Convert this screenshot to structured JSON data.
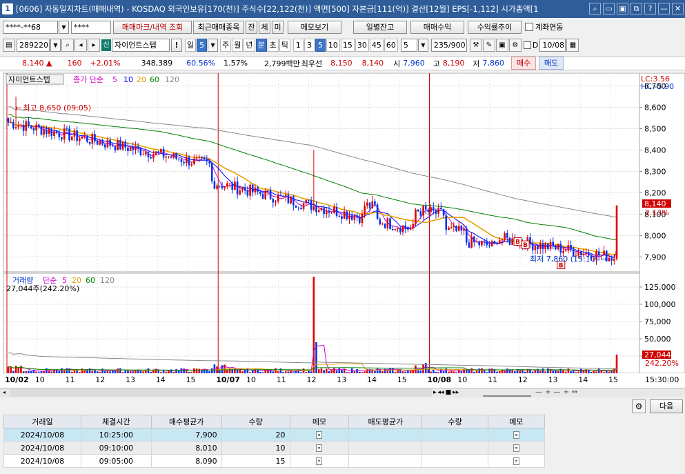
{
  "title": {
    "num": "1",
    "text": "[0606] 자동일지차트(매매내역) - KOSDAQ 외국인보유[170(천)] 주식수[22,122(천)] 액면[500] 자본금[111(억)] 결산[12월] EPS[-1,112] 시가총액[1"
  },
  "window_buttons": [
    "⌕",
    "▭",
    "▣",
    "⧉",
    "?",
    "—",
    "✕"
  ],
  "row1": {
    "account": "****-**68",
    "password": "****",
    "mark_btn": "매매마크/내역 조회",
    "recent_btn": "최근매매종목",
    "jan": "잔",
    "che": "체",
    "mi": "미",
    "memo_btn": "메모보기",
    "daily_btn": "일별잔고",
    "profit_btn": "매매수익",
    "rate_btn": "수익률추이",
    "link_label": "계좌연동"
  },
  "row2": {
    "code": "289220",
    "badge": "신",
    "stock_name": "자이언트스텝",
    "warn": "!",
    "day": "일",
    "day_val": "5",
    "periods": [
      "주",
      "월",
      "년",
      "분",
      "초",
      "틱",
      "1",
      "3",
      "5",
      "10",
      "15",
      "30",
      "45",
      "60"
    ],
    "count": "5",
    "view": "235/900",
    "d_label": "D",
    "date": "10/08"
  },
  "quote": {
    "price": "8,140 ▲",
    "change": "160",
    "pct": "+2.01%",
    "volume": "348,389",
    "vol_ratio": "60.56%",
    "turnover": "1.57%",
    "amount": "2,799백만",
    "first": "최우선",
    "bid1": "8,150",
    "bid2": "8,140",
    "open_label": "시",
    "open": "7,960",
    "high_label": "고",
    "high": "8,190",
    "low_label": "저",
    "low": "7,860",
    "buy_btn": "매수",
    "sell_btn": "매도"
  },
  "chart": {
    "stock_label": "자이언트스텝",
    "ma_label": "종가 단순",
    "ma_periods": [
      "5",
      "10",
      "20",
      "60",
      "120"
    ],
    "ma_colors": [
      "#cc00cc",
      "#0000ff",
      "#e8a000",
      "#008000",
      "#888888"
    ],
    "lc": "LC:3.56",
    "hc": "HC:-5.90",
    "high_note": "최고 8,650 (09:05)",
    "low_note": "최저 7,860 (15:10)",
    "price_axis": [
      "8,700",
      "8,600",
      "8,500",
      "8,400",
      "8,300",
      "8,200",
      "8,100",
      "8,000",
      "7,900"
    ],
    "price_axis_values": [
      8700,
      8600,
      8500,
      8400,
      8300,
      8200,
      8100,
      8000,
      7900
    ],
    "cur_price": "8,140",
    "cur_pct": "2.13%",
    "vol_label": "거래량",
    "vol_ma_label": "단순",
    "vol_ma_periods": [
      "5",
      "20",
      "60",
      "120"
    ],
    "vol_sub": "27,044주(242.20%)",
    "vol_axis": [
      "125,000",
      "100,000",
      "75,000",
      "50,000",
      "25,000"
    ],
    "vol_axis_values": [
      125000,
      100000,
      75000,
      50000,
      25000
    ],
    "vol_cur": "27,044",
    "vol_pct": "242.20%",
    "x_labels": [
      "10/02",
      "10",
      "11",
      "12",
      "13",
      "14",
      "15",
      "10/07",
      "10",
      "11",
      "12",
      "13",
      "14",
      "15",
      "10/08",
      "10",
      "11",
      "12",
      "13",
      "14",
      "15"
    ],
    "x_label_bold": [
      true,
      false,
      false,
      false,
      false,
      false,
      false,
      true,
      false,
      false,
      false,
      false,
      false,
      false,
      true,
      false,
      false,
      false,
      false,
      false,
      false
    ],
    "time_label": "15:30:00",
    "markers": [
      "B",
      "B",
      "B"
    ]
  },
  "chart_data": {
    "type": "candlestick",
    "price_high": 8650,
    "price_low": 7860,
    "ylim": [
      7830,
      8760
    ],
    "vol_ylim": [
      0,
      145000
    ],
    "day_dividers": [
      "10/07",
      "10/08"
    ],
    "last_close": 8140,
    "last_volume": 27044,
    "volume_peaks": [
      140000,
      45000
    ]
  },
  "bottom_tools": [
    "▸",
    "◂◂",
    "■",
    "▸▸",
    "—",
    "+",
    "—",
    "+",
    "↔"
  ],
  "toolbar": {
    "next": "다음"
  },
  "table": {
    "headers": [
      "거래일",
      "체결시간",
      "매수평균가",
      "수량",
      "메모",
      "매도평균가",
      "수량",
      "메모"
    ],
    "rows": [
      [
        "2024/10/08",
        "10:25:00",
        "7,900",
        "20",
        "",
        "",
        "",
        ""
      ],
      [
        "2024/10/08",
        "09:10:00",
        "8,010",
        "10",
        "",
        "",
        "",
        ""
      ],
      [
        "2024/10/08",
        "09:05:00",
        "8,090",
        "15",
        "",
        "",
        "",
        ""
      ]
    ]
  }
}
